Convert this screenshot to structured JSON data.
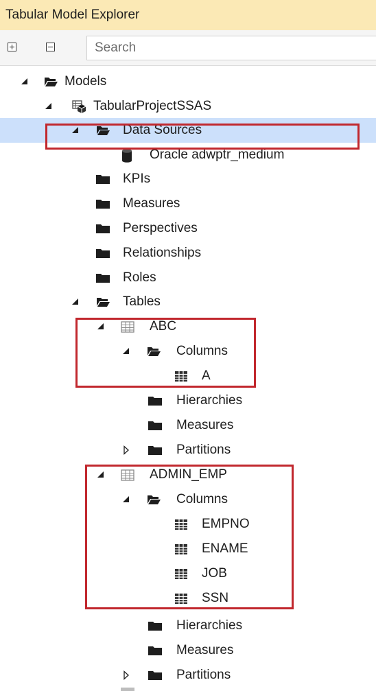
{
  "window": {
    "title": "Tabular Model Explorer"
  },
  "toolbar": {
    "expand_all": "expand-all",
    "collapse_all": "collapse-all",
    "search_placeholder": "Search"
  },
  "tree": {
    "models": "Models",
    "project": "TabularProjectSSAS",
    "data_sources": "Data Sources",
    "oracle": "Oracle adwptr_medium",
    "kpis": "KPIs",
    "measures": "Measures",
    "perspectives": "Perspectives",
    "relationships": "Relationships",
    "roles": "Roles",
    "tables": "Tables",
    "abc": {
      "name": "ABC",
      "columns": "Columns",
      "col_a": "A",
      "hierarchies": "Hierarchies",
      "measures": "Measures",
      "partitions": "Partitions"
    },
    "admin_emp": {
      "name": "ADMIN_EMP",
      "columns": "Columns",
      "col_empno": "EMPNO",
      "col_ename": "ENAME",
      "col_job": "JOB",
      "col_ssn": "SSN",
      "hierarchies": "Hierarchies",
      "measures": "Measures",
      "partitions": "Partitions"
    }
  },
  "colors": {
    "title_bg": "#fbe9b5",
    "selection": "#cce0fb",
    "highlight": "#c1272d"
  }
}
